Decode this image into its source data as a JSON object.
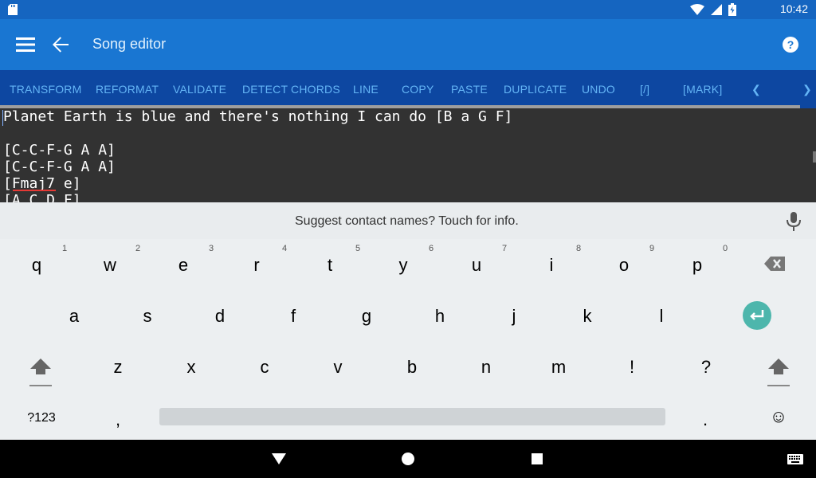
{
  "status_bar": {
    "time": "10:42",
    "icons": [
      "sd-card-icon",
      "wifi-icon",
      "signal-icon",
      "battery-icon"
    ]
  },
  "app_bar": {
    "title": "Song editor"
  },
  "toolbar": {
    "buttons": [
      "TRANSFORM",
      "REFORMAT",
      "VALIDATE",
      "DETECT CHORDS",
      "LINE",
      "COPY",
      "PASTE",
      "DUPLICATE",
      "UNDO",
      "[/]",
      "[MARK]",
      "❮",
      "❯"
    ]
  },
  "editor": {
    "lines": [
      "Planet Earth is blue and there's nothing I can do [B a G F]",
      "",
      "[C-C-F-G A A]",
      "[C-C-F-G A A]",
      "[Fmaj7 e]",
      "[A C D F]"
    ]
  },
  "keyboard": {
    "suggestion_text": "Suggest contact names? Touch for info.",
    "row1": [
      "q",
      "w",
      "e",
      "r",
      "t",
      "y",
      "u",
      "i",
      "o",
      "p"
    ],
    "row1_hints": [
      "1",
      "2",
      "3",
      "4",
      "5",
      "6",
      "7",
      "8",
      "9",
      "0"
    ],
    "row2": [
      "a",
      "s",
      "d",
      "f",
      "g",
      "h",
      "j",
      "k",
      "l"
    ],
    "row3": [
      "z",
      "x",
      "c",
      "v",
      "b",
      "n",
      "m",
      "!",
      "?"
    ],
    "row4": [
      "?123",
      ",",
      ".",
      "☺"
    ]
  },
  "colors": {
    "status_bar": "#1565c0",
    "app_bar": "#1976d2",
    "toolbar": "#0d47a1",
    "toolbar_text": "#64b5f6",
    "editor_bg": "#323232",
    "keyboard_bg": "#eceff1",
    "enter_key": "#4db6ac"
  }
}
